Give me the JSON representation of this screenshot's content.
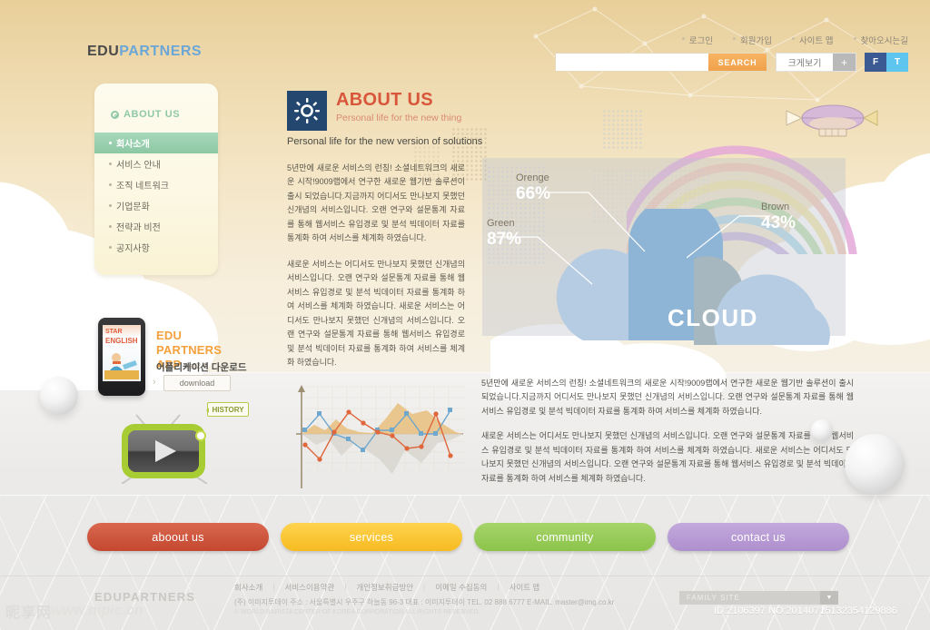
{
  "brand": {
    "edu": "EDU",
    "partners": "PARTNERS"
  },
  "topnav": {
    "items": [
      {
        "label": "로그인"
      },
      {
        "label": "회원가입"
      },
      {
        "label": "사이트 맵"
      },
      {
        "label": "찾아오시는길"
      }
    ]
  },
  "toolbar": {
    "search_value": "",
    "search_placeholder": "",
    "search_button": "SEARCH",
    "zoom_label": "크게보기",
    "zoom_plus": "+",
    "social_facebook": "F",
    "social_twitter": "T"
  },
  "sidebar": {
    "title": "ABOUT US",
    "items": [
      {
        "label": "회사소개",
        "active": true
      },
      {
        "label": "서비스 안내",
        "active": false
      },
      {
        "label": "조직 네트워크",
        "active": false
      },
      {
        "label": "기업문화",
        "active": false
      },
      {
        "label": "전략과 비전",
        "active": false
      },
      {
        "label": "공지사항",
        "active": false
      }
    ]
  },
  "content": {
    "icon": "sun-icon",
    "title": "ABOUT US",
    "subtitle": "Personal life for the new thing",
    "lead": "Personal life for the new version of solutions",
    "left_para1": "5년만에 새로운 서비스의 런칭! 소셜네트워크의 새로운 시작!9009랩에서 연구한 새로운 웹기반 솔루션이 출시 되었습니다.지금까지 어디서도 만나보지 못했던 신개념의 서비스입니다. 오랜 연구와 설문통계 자료를 통해 웹서비스 유입경로 및 분석 빅데이터 자료를 통계화 하여 서비스를 체계화 하였습니다.",
    "left_para2": "새로운 서비스는 어디서도 만나보지 못했던 신개념의 서비스입니다. 오랜 연구와 설문통계 자료를 통해 웹서비스 유입경로 및 분석 빅데이터 자료를 통계화 하여 서비스를 체계화 하였습니다. 새로운 서비스는 어디서도 만나보지 못했던 신개념의 서비스입니다. 오랜 연구와 설문통계 자료를 통해 웹서비스 유입경로 및 분석 빅데이터 자료를 통계화 하여 서비스를 체계화 하였습니다.",
    "right_para1": "5년만에 새로운 서비스의 런칭! 소셜네트워크의 새로운 시작!9009랩에서 연구한 새로운 웹기반 솔루션이 출시 되었습니다.지금까지 어디서도 만나보지 못했던 신개념의 서비스입니다. 오랜 연구와 설문통계 자료를 통해 웹서비스 유입경로 및 분석 빅데이터 자료를 통계화 하여 서비스를 체계화 하였습니다.",
    "right_para2": "새로운 서비스는 어디서도 만나보지 못했던 신개념의 서비스입니다. 오랜 연구와 설문통계 자료를 통해 웹서비스 유입경로 및 분석 빅데이터 자료를 통계화 하여 서비스를 체계화 하였습니다. 새로운 서비스는 어디서도 만나보지 못했던 신개념의 서비스입니다. 오랜 연구와 설문통계 자료를 통해 웹서비스 유입경로 및 분석 빅데이터 자료를 통계화 하여 서비스를 체계화 하였습니다."
  },
  "cloud_panel": {
    "headline": "CLOUD",
    "stats": [
      {
        "name": "Orenge",
        "value": "66%"
      },
      {
        "name": "Green",
        "value": "87%"
      },
      {
        "name": "Brown",
        "value": "43%"
      }
    ]
  },
  "app_promo": {
    "phone_line1": "STAR",
    "phone_line2": "ENGLISH",
    "title_line1": "EDU",
    "title_line2": "PARTNERS",
    "title_line3": "APP",
    "version": "ver2.0",
    "korean": "어플리케이션 다운로드",
    "download_label": "download",
    "arrow": "›"
  },
  "video": {
    "tooltip": "HISTORY",
    "play": "play-icon"
  },
  "chart_data": {
    "type": "line",
    "title": "",
    "xlabel": "",
    "ylabel": "",
    "x": [
      0,
      1,
      2,
      3,
      4,
      5,
      6,
      7,
      8,
      9,
      10
    ],
    "ylim": [
      -60,
      60
    ],
    "grid": true,
    "legend": "none",
    "series": [
      {
        "name": "blue",
        "color": "#6fa8cf",
        "values": [
          6,
          34,
          2,
          -6,
          -22,
          6,
          6,
          34,
          4,
          4,
          42
        ]
      },
      {
        "name": "orange",
        "color": "#e0663c",
        "values": [
          -14,
          -36,
          4,
          40,
          22,
          6,
          2,
          -18,
          -16,
          38,
          -24
        ]
      },
      {
        "name": "area-orange",
        "color": "#e6bb7a",
        "values": [
          16,
          10,
          22,
          6,
          18,
          4,
          2,
          26,
          44,
          28,
          10
        ]
      },
      {
        "name": "area-grey",
        "color": "#d9d7d0",
        "values": [
          -10,
          -22,
          -8,
          -26,
          -12,
          -20,
          -30,
          -46,
          -20,
          -34,
          -12
        ]
      }
    ]
  },
  "bottom_buttons": [
    {
      "label": "aboout us",
      "color": "#c4472f"
    },
    {
      "label": "services",
      "color": "#f6bb22"
    },
    {
      "label": "community",
      "color": "#8cc44b"
    },
    {
      "label": "contact us",
      "color": "#ae8fcd"
    }
  ],
  "footer": {
    "logo": "EDUPARTNERS",
    "links": [
      "회사소개",
      "서비스이용약관",
      "개인정보취급방안",
      "이메일 수집동의",
      "사이트 맵"
    ],
    "address": "(주) 이미지투데이    주소 : 서울특별시 우주구 하늘동 96-3    대표 : 이미지투데이    TEL. 02 888 6777    E-MAIL. master@img.co.kr",
    "copyright": "© WORLD BARISTA CENTER OF KOREA CORPORATION ALL RIGHTS RESERVED.",
    "family_site": "FAMILY SITE",
    "family_arrow": "▼"
  },
  "watermark": {
    "cjk": "昵享网",
    "site": "www.nipic.cn",
    "id": "ID:2106397 NO:20140715132354129886"
  },
  "colors": {
    "accent_orange": "#f4a03c",
    "title_red": "#d8563a",
    "brand_blue": "#6aa7d8",
    "sidebar_green": "#8cc7a4",
    "icon_navy": "#24476f"
  }
}
